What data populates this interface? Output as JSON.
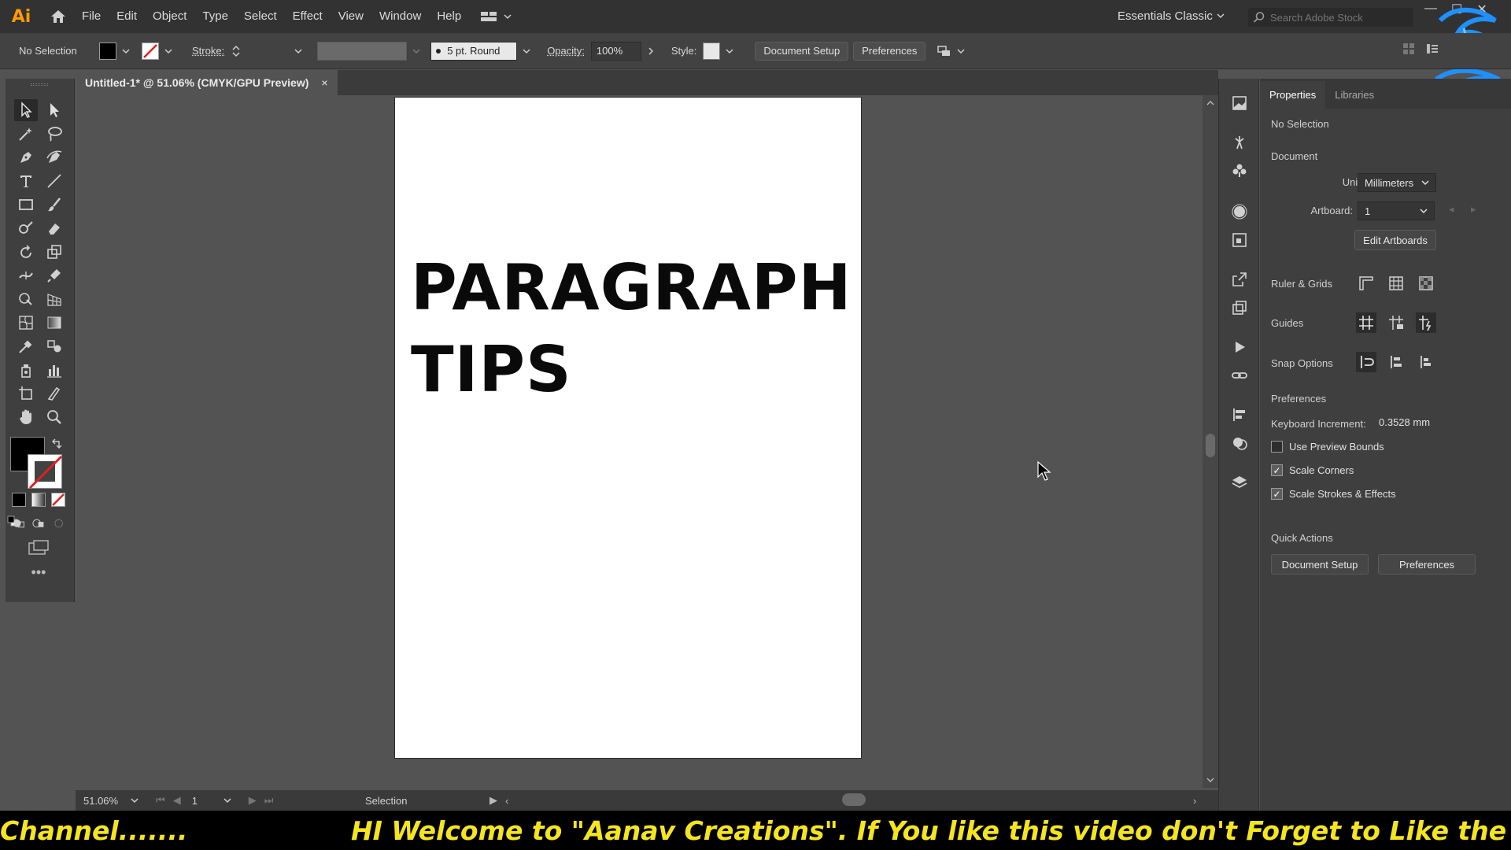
{
  "app": {
    "logo": "Ai"
  },
  "menu": [
    "File",
    "Edit",
    "Object",
    "Type",
    "Select",
    "Effect",
    "View",
    "Window",
    "Help"
  ],
  "workspace": {
    "name": "Essentials Classic"
  },
  "search": {
    "placeholder": "Search Adobe Stock"
  },
  "control_bar": {
    "selection": "No Selection",
    "stroke_label": "Stroke:",
    "brush": "5 pt. Round",
    "opacity_label": "Opacity:",
    "opacity_value": "100%",
    "style_label": "Style:",
    "document_setup": "Document Setup",
    "preferences": "Preferences"
  },
  "tab": {
    "title": "Untitled-1* @ 51.06% (CMYK/GPU Preview)",
    "close": "×"
  },
  "artboard": {
    "line1": "PARAGRAPH",
    "line2": "TIPS"
  },
  "status": {
    "zoom": "51.06%",
    "artboard_num": "1",
    "tool": "Selection"
  },
  "properties": {
    "tabs": [
      "Properties",
      "Libraries"
    ],
    "selection": "No Selection",
    "document_heading": "Document",
    "units_label": "Units:",
    "units_value": "Millimeters",
    "artboard_label": "Artboard:",
    "artboard_value": "1",
    "edit_artboards": "Edit Artboards",
    "ruler_grids": "Ruler & Grids",
    "guides": "Guides",
    "snap_options": "Snap Options",
    "preferences_heading": "Preferences",
    "keyboard_increment_label": "Keyboard Increment:",
    "keyboard_increment_value": "0.3528 mm",
    "use_preview_bounds": "Use Preview Bounds",
    "scale_corners": "Scale Corners",
    "scale_strokes": "Scale Strokes & Effects",
    "quick_actions": "Quick Actions",
    "qa_document_setup": "Document Setup",
    "qa_preferences": "Preferences"
  },
  "ticker": {
    "left": "Channel.......",
    "main": "HI Welcome to \"Aanav Creations\". If You like this video don't Forget to Like the video, S"
  },
  "colors": {
    "accent_ticker": "#f5e51f",
    "ai_logo": "#ff9a00",
    "channel_logo": "#1e90ff"
  }
}
